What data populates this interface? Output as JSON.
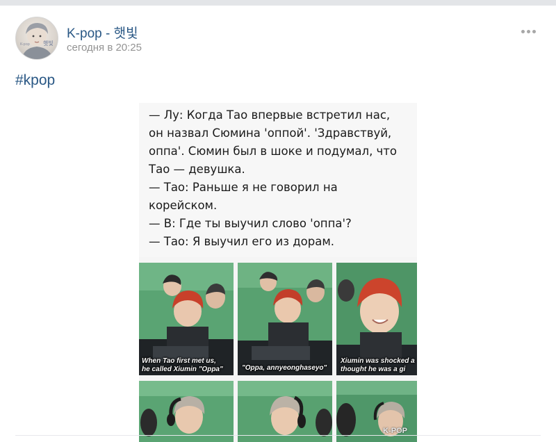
{
  "post": {
    "group_name": "K-pop - 햇빛",
    "time": "сегодня в 20:25",
    "hashtag": "#kpop",
    "more_icon": "more-horizontal-icon",
    "avatar_text": "햇빛",
    "avatar_small_text": "K-pop"
  },
  "image": {
    "text_lines": [
      "— Лу: Когда Тао впервые встретил нас,",
      "он назвал Сюмина 'оппой'. 'Здравствуй,",
      "оппа'. Сюмин был в шоке и подумал, что",
      "Тао — девушка.",
      "— Тао: Раньше я не говорил на",
      "корейском.",
      "— В: Где ты выучил слово 'оппа'?",
      "— Тао: Я выучил его из дорам."
    ],
    "captions": [
      "When Tao first met us,",
      "he called Xiumin \"Oppa\"",
      "\"Oppa, annyeonghaseyo\"",
      "Xiumin was shocked a",
      "thought he was a gi"
    ],
    "watermark": "K-POP"
  },
  "colors": {
    "link": "#2a5885",
    "time": "#939393",
    "studio_green": "#4f9a6a",
    "hair_red": "#c8402a"
  }
}
